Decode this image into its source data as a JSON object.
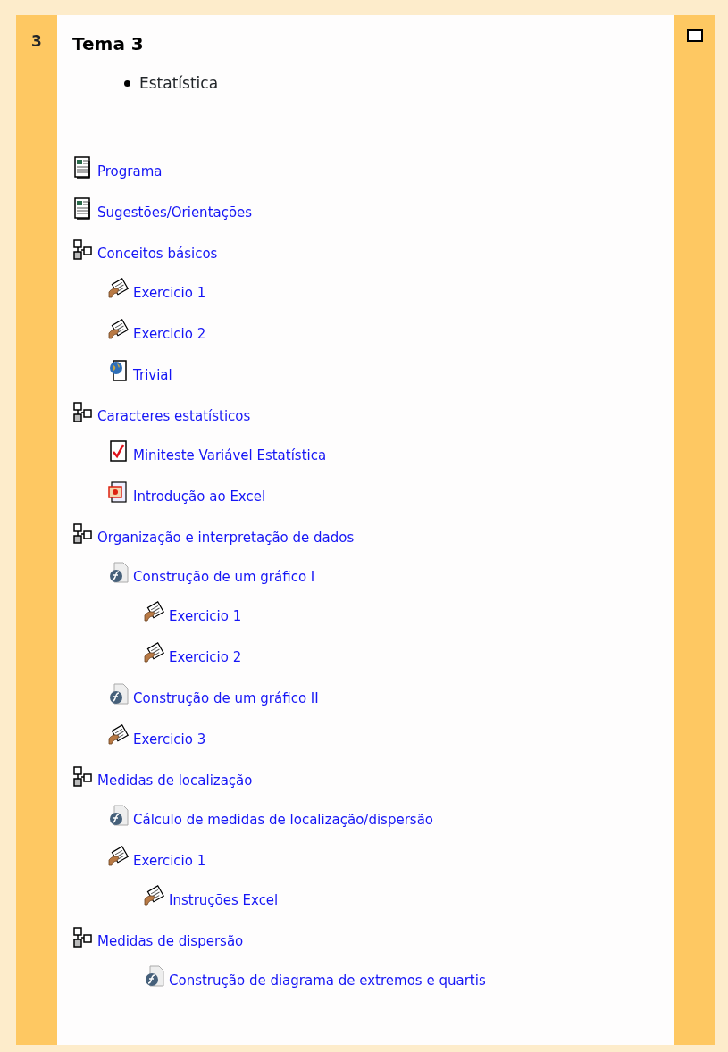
{
  "section": {
    "number": "3",
    "title": "Tema 3",
    "summary": [
      "Estatística"
    ]
  },
  "items": [
    {
      "kind": "page",
      "label": "Programa"
    },
    {
      "kind": "page",
      "label": "Sugestões/Orientações"
    },
    {
      "kind": "group",
      "label": "Conceitos básicos",
      "children": [
        {
          "kind": "assignment",
          "label": "Exercicio 1"
        },
        {
          "kind": "assignment",
          "label": "Exercicio 2"
        },
        {
          "kind": "web",
          "label": "Trivial"
        }
      ]
    },
    {
      "kind": "group",
      "label": "Caracteres estatísticos",
      "children": [
        {
          "kind": "quiz",
          "label": "Miniteste Variável Estatística"
        },
        {
          "kind": "slides",
          "label": "Introdução ao Excel"
        }
      ]
    },
    {
      "kind": "group",
      "label": "Organização e interpretação de dados",
      "children": [
        {
          "kind": "flash",
          "label": "Construção de um gráfico I",
          "children": [
            {
              "kind": "assignment",
              "label": "Exercicio 1"
            },
            {
              "kind": "assignment",
              "label": "Exercicio 2"
            }
          ]
        },
        {
          "kind": "flash",
          "label": "Construção de um gráfico II"
        },
        {
          "kind": "assignment",
          "label": "Exercicio 3"
        }
      ]
    },
    {
      "kind": "group",
      "label": "Medidas de localização",
      "children": [
        {
          "kind": "flash",
          "label": "Cálculo de medidas de localização/dispersão"
        },
        {
          "kind": "assignment",
          "label": "Exercicio 1",
          "children": [
            {
              "kind": "assignment",
              "label": "Instruções Excel"
            }
          ]
        }
      ]
    },
    {
      "kind": "group",
      "label": "Medidas de dispersão",
      "children": [
        {
          "children": [
            {
              "kind": "flash",
              "label": "Construção de diagrama de extremos e quartis"
            }
          ]
        }
      ]
    }
  ]
}
